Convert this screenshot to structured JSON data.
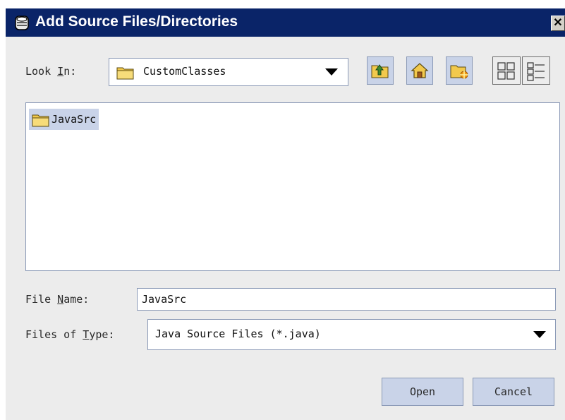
{
  "window": {
    "title": "Add Source Files/Directories",
    "close_glyph": "✕"
  },
  "look_in": {
    "label_pre": "Look ",
    "label_mnemonic": "I",
    "label_post": "n:",
    "value": "CustomClasses",
    "icon": "folder-icon"
  },
  "toolbar": [
    {
      "name": "up-one-level-button",
      "icon": "folder-up-icon"
    },
    {
      "name": "home-button",
      "icon": "home-icon"
    },
    {
      "name": "new-folder-button",
      "icon": "new-folder-icon"
    },
    {
      "name": "list-view-button",
      "icon": "list-view-icon"
    },
    {
      "name": "details-view-button",
      "icon": "details-view-icon"
    }
  ],
  "file_list": {
    "items": [
      {
        "label": "JavaSrc",
        "icon": "folder-icon",
        "selected": true
      }
    ]
  },
  "file_name": {
    "label_pre": "File ",
    "label_mnemonic": "N",
    "label_post": "ame:",
    "value": "JavaSrc"
  },
  "files_of_type": {
    "label_pre": "Files of ",
    "label_mnemonic": "T",
    "label_post": "ype:",
    "value": "Java Source Files (*.java)"
  },
  "buttons": {
    "open": "Open",
    "cancel": "Cancel"
  },
  "colors": {
    "title_bar": "#0a2468",
    "accent_fill": "#c9d3e8",
    "border": "#8a99b6",
    "folder": "#f2c94c"
  }
}
